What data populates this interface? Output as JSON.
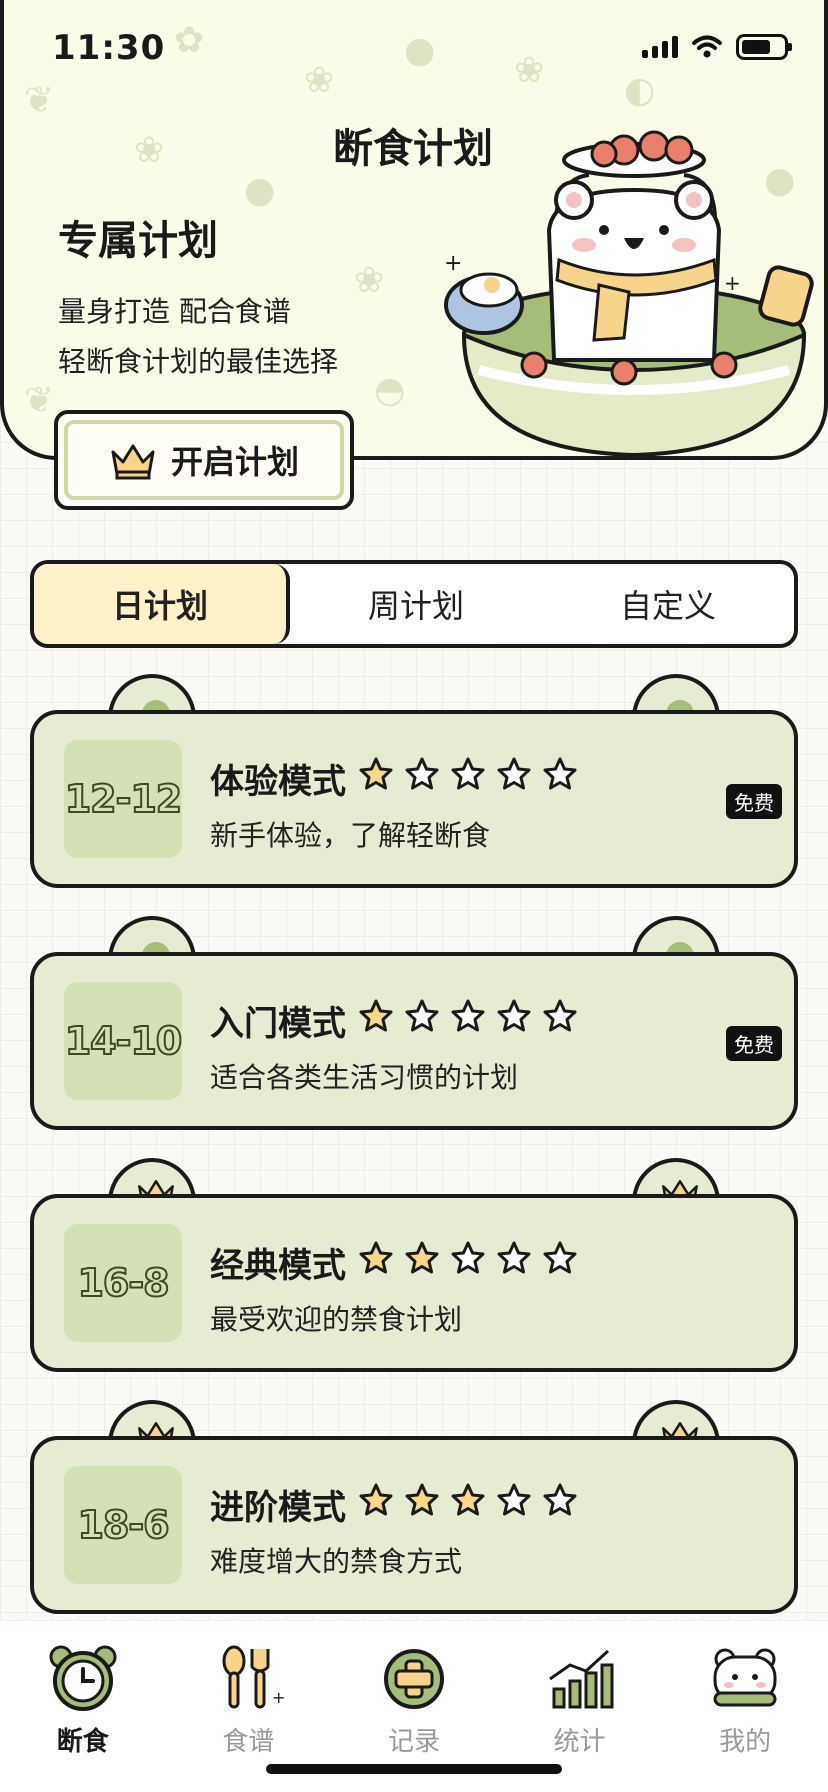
{
  "status_bar": {
    "time": "11:30"
  },
  "header": {
    "page_title": "断食计划",
    "plan_title": "专属计划",
    "plan_desc_line1": "量身打造 配合食谱",
    "plan_desc_line2": "轻断食计划的最佳选择",
    "start_button_label": "开启计划"
  },
  "tabs": [
    {
      "label": "日计划",
      "active": true
    },
    {
      "label": "周计划",
      "active": false
    },
    {
      "label": "自定义",
      "active": false
    }
  ],
  "plans": [
    {
      "ratio": "12-12",
      "title": "体验模式",
      "subtitle": "新手体验，了解轻断食",
      "stars_filled": 1,
      "stars_total": 5,
      "badge": "免费",
      "premium": false
    },
    {
      "ratio": "14-10",
      "title": "入门模式",
      "subtitle": "适合各类生活习惯的计划",
      "stars_filled": 1,
      "stars_total": 5,
      "badge": "免费",
      "premium": false
    },
    {
      "ratio": "16-8",
      "title": "经典模式",
      "subtitle": "最受欢迎的禁食计划",
      "stars_filled": 2,
      "stars_total": 5,
      "badge": "",
      "premium": true
    },
    {
      "ratio": "18-6",
      "title": "进阶模式",
      "subtitle": "难度增大的禁食方式",
      "stars_filled": 3,
      "stars_total": 5,
      "badge": "",
      "premium": true
    }
  ],
  "bottom_nav": [
    {
      "label": "断食",
      "icon": "clock-icon",
      "active": true
    },
    {
      "label": "食谱",
      "icon": "spoon-fork-icon",
      "active": false
    },
    {
      "label": "记录",
      "icon": "plus-record-icon",
      "active": false
    },
    {
      "label": "统计",
      "icon": "chart-icon",
      "active": false
    },
    {
      "label": "我的",
      "icon": "bear-profile-icon",
      "active": false
    }
  ],
  "colors": {
    "card_bg": "#e6ebd3",
    "accent_green": "#a5bd78",
    "tab_active": "#fcf1c7",
    "star_fill": "#f7d88a"
  }
}
